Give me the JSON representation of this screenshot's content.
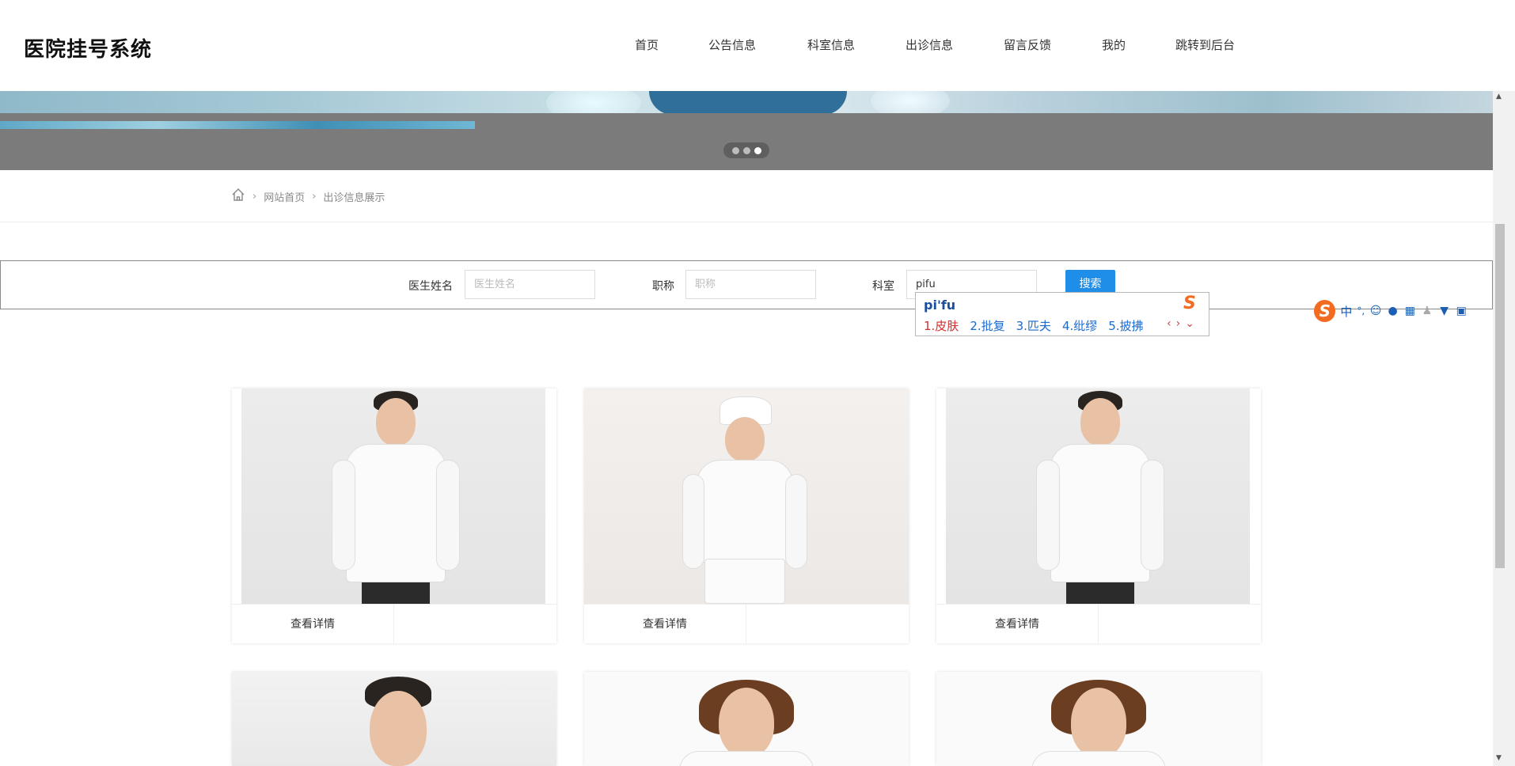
{
  "header": {
    "logo": "医院挂号系统",
    "nav": [
      "首页",
      "公告信息",
      "科室信息",
      "出诊信息",
      "留言反馈",
      "我的",
      "跳转到后台"
    ]
  },
  "breadcrumb": {
    "home": "网站首页",
    "current": "出诊信息展示"
  },
  "search": {
    "doctor_name_label": "医生姓名",
    "doctor_name_placeholder": "医生姓名",
    "title_label": "职称",
    "title_placeholder": "职称",
    "dept_label": "科室",
    "dept_value": "pifu",
    "button": "搜索"
  },
  "ime": {
    "pinyin": "pi'fu",
    "candidates": [
      "1.皮肤",
      "2.批复",
      "3.匹夫",
      "4.纰缪",
      "5.披拂"
    ],
    "toolbar_mode": "中",
    "toolbar_punct": "°,"
  },
  "cards": [
    {
      "detail": "查看详情"
    },
    {
      "detail": "查看详情"
    },
    {
      "detail": "查看详情"
    }
  ],
  "carousel": {
    "count": 3,
    "active": 2
  }
}
